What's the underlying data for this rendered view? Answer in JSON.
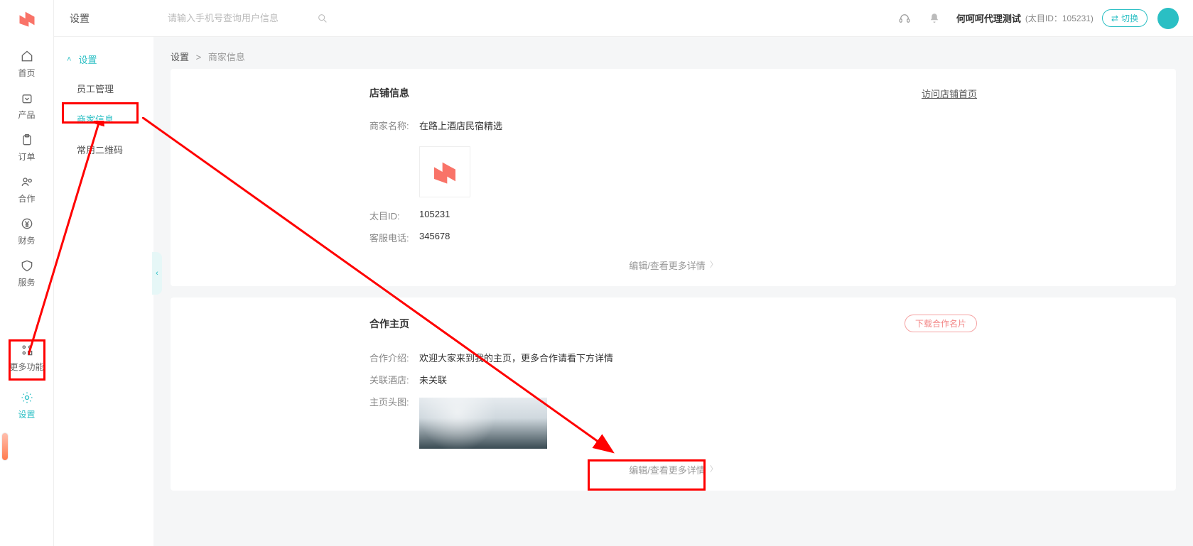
{
  "header": {
    "search_placeholder": "请输入手机号查询用户信息",
    "user_name": "何呵呵代理测试",
    "user_id_label": "(太目ID：105231)",
    "switch_label": "切换"
  },
  "rail": {
    "items": [
      "首页",
      "产品",
      "订单",
      "合作",
      "财务",
      "服务"
    ],
    "more": "更多功能",
    "settings": "设置"
  },
  "sidenav": {
    "title": "设置",
    "group_title": "设置",
    "items": [
      "员工管理",
      "商家信息",
      "常用二维码"
    ]
  },
  "breadcrumb": {
    "root": "设置",
    "current": "商家信息"
  },
  "cards": {
    "shop": {
      "title": "店铺信息",
      "head_link": "访问店铺首页",
      "rows": {
        "name_label": "商家名称:",
        "name_value": "在路上酒店民宿精选",
        "id_label": "太目ID:",
        "id_value": "105231",
        "tel_label": "客服电话:",
        "tel_value": "345678"
      },
      "footer": "编辑/查看更多详情"
    },
    "coop": {
      "title": "合作主页",
      "head_btn": "下载合作名片",
      "rows": {
        "intro_label": "合作介绍:",
        "intro_value": "欢迎大家来到我的主页，更多合作请看下方详情",
        "hotel_label": "关联酒店:",
        "hotel_value": "未关联",
        "thumb_label": "主页头图:"
      },
      "footer": "编辑/查看更多详情"
    }
  }
}
